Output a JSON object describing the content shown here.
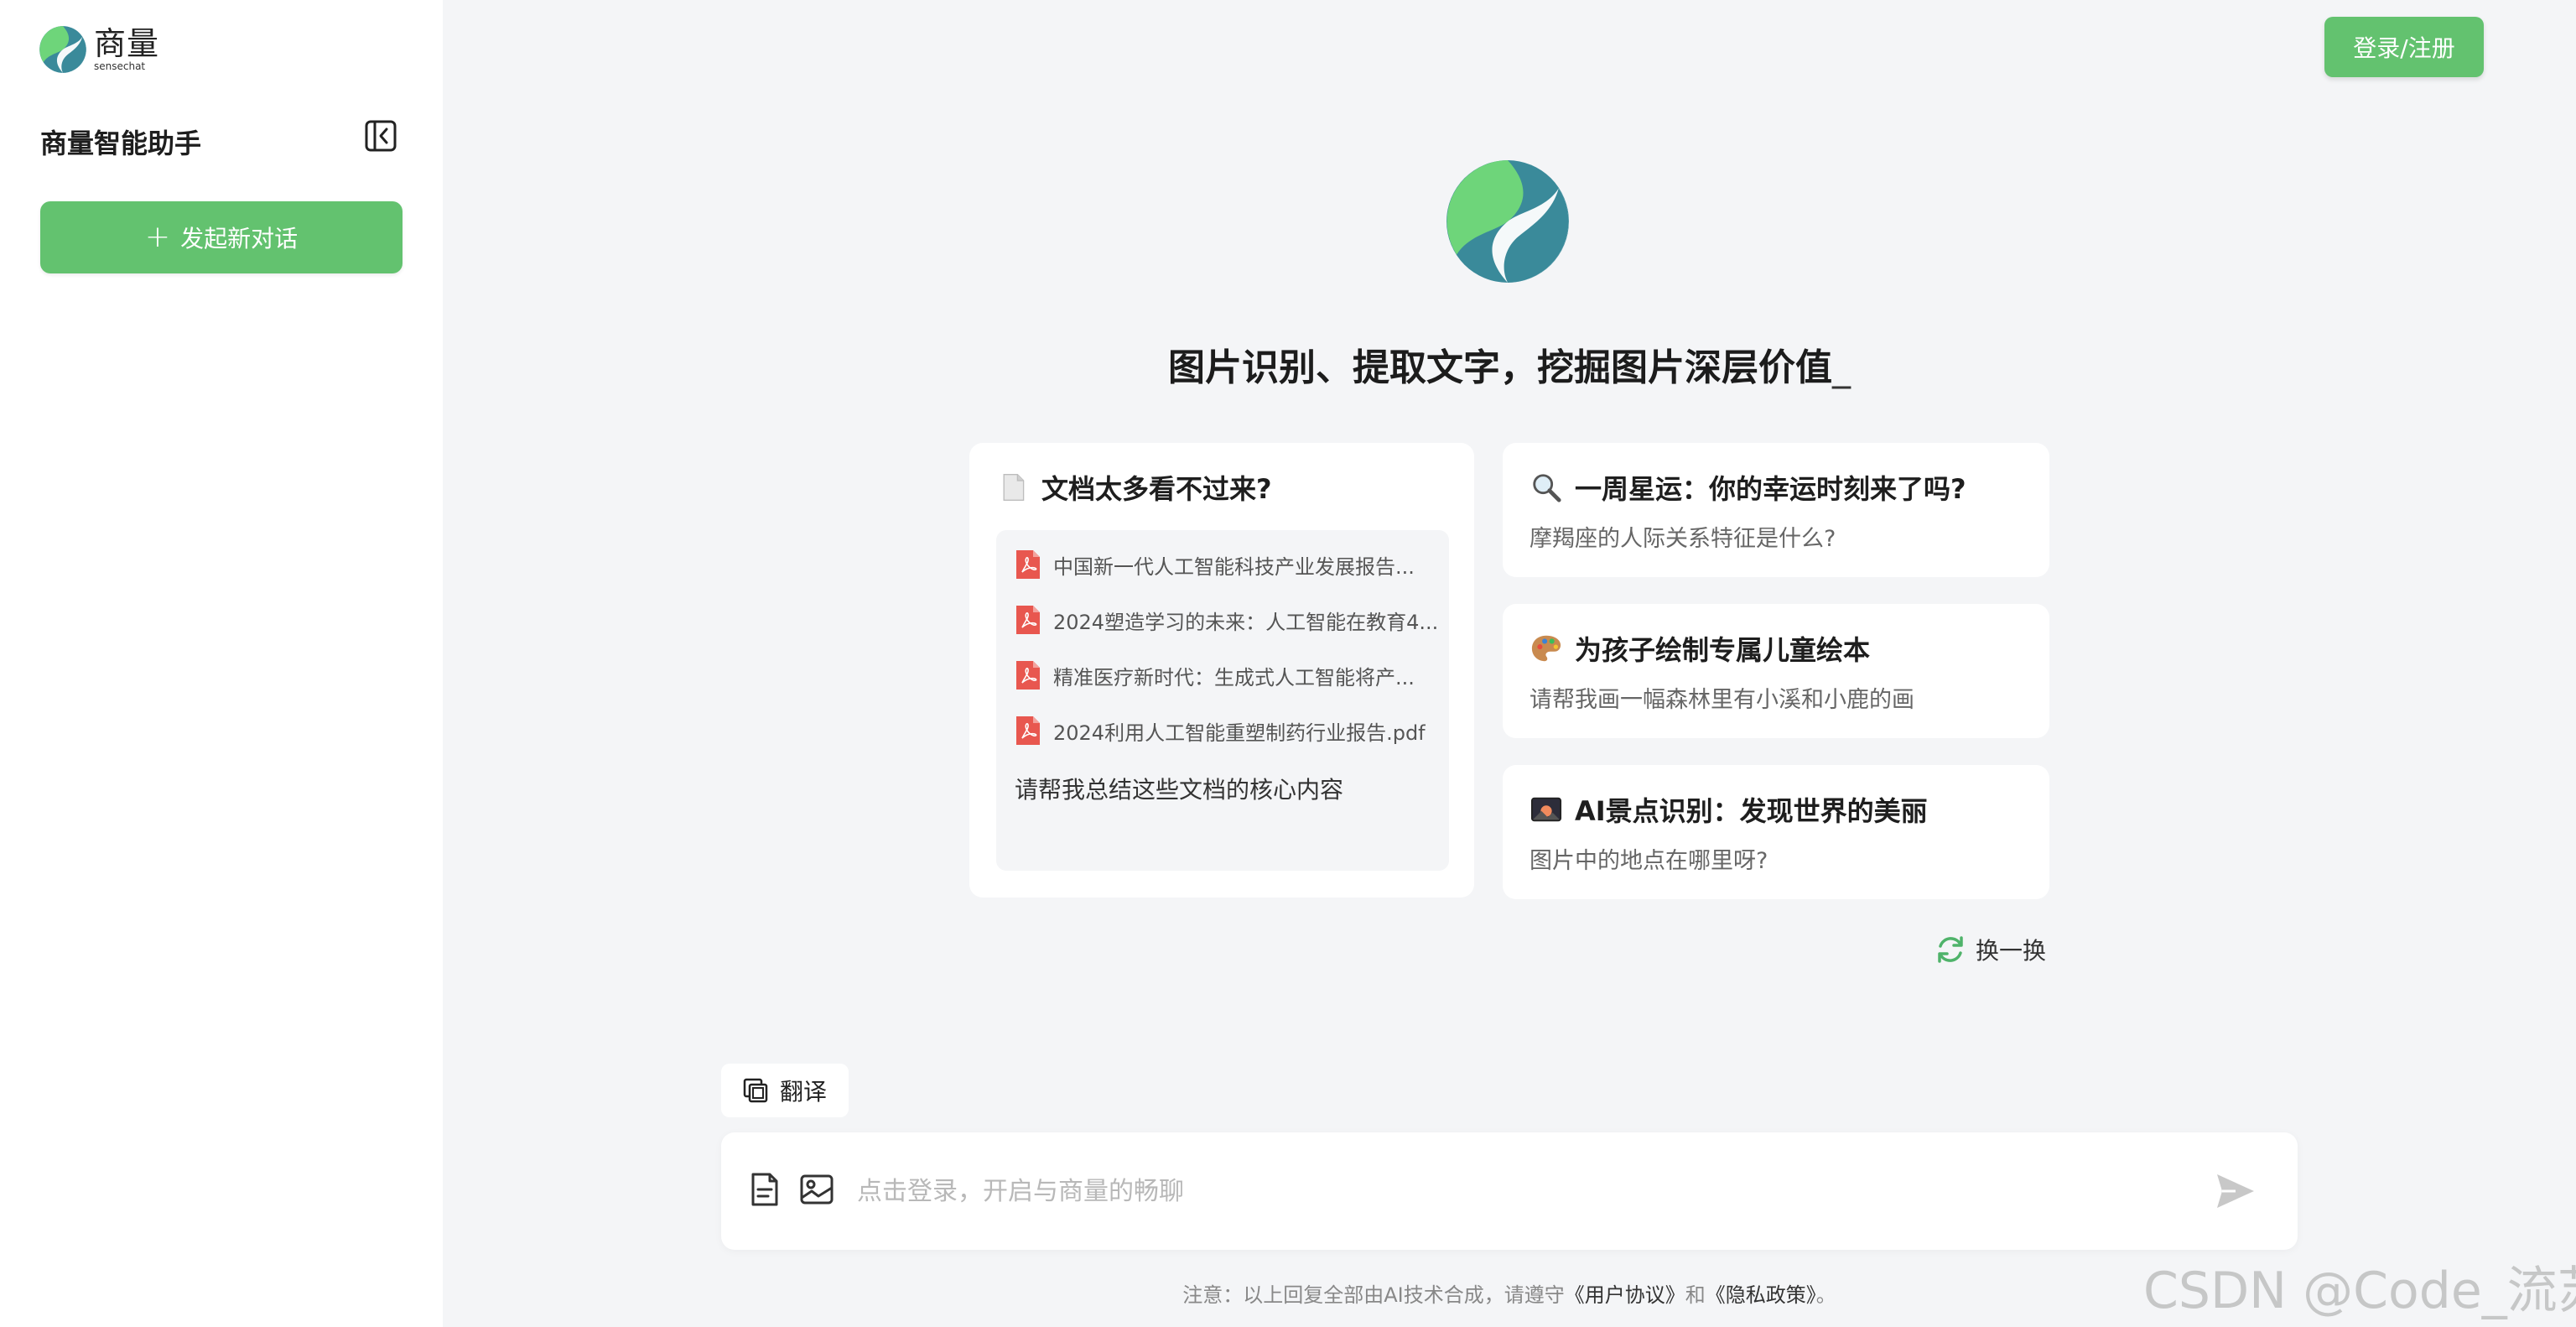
{
  "sidebar": {
    "logo_cn": "商量",
    "logo_en": "sensechat",
    "assistant_title": "商量智能助手",
    "new_chat_label": "发起新对话"
  },
  "header": {
    "login_label": "登录/注册"
  },
  "hero": {
    "title": "图片识别、提取文字，挖掘图片深层价值",
    "cursor": "_"
  },
  "doc_card": {
    "title": "文档太多看不过来?",
    "files": [
      "中国新一代人工智能科技产业发展报告...",
      "2024塑造学习的未来：人工智能在教育4...",
      "精准医疗新时代：生成式人工智能将产...",
      "2024利用人工智能重塑制药行业报告.pdf"
    ],
    "prompt": "请帮我总结这些文档的核心内容"
  },
  "cards": [
    {
      "title": "一周星运：你的幸运时刻来了吗?",
      "sub": "摩羯座的人际关系特征是什么?",
      "icon": "magnifier-icon"
    },
    {
      "title": "为孩子绘制专属儿童绘本",
      "sub": "请帮我画一幅森林里有小溪和小鹿的画",
      "icon": "palette-icon"
    },
    {
      "title": "AI景点识别：发现世界的美丽",
      "sub": "图片中的地点在哪里呀?",
      "icon": "landscape-photo-icon"
    }
  ],
  "refresh_label": "换一换",
  "translate_label": "翻译",
  "input": {
    "placeholder": "点击登录，开启与商量的畅聊"
  },
  "disclaimer": {
    "prefix": "注意：以上回复全部由AI技术合成，请遵守",
    "user_agreement": "《用户协议》",
    "and": "和",
    "privacy_policy": "《隐私政策》",
    "suffix": "。"
  },
  "watermark": "CSDN @Code_流苏",
  "colors": {
    "brand_green": "#63c26f",
    "logo_teal": "#3a8a9a",
    "logo_light_green": "#6ed57a",
    "pdf_red": "#e8574f"
  }
}
